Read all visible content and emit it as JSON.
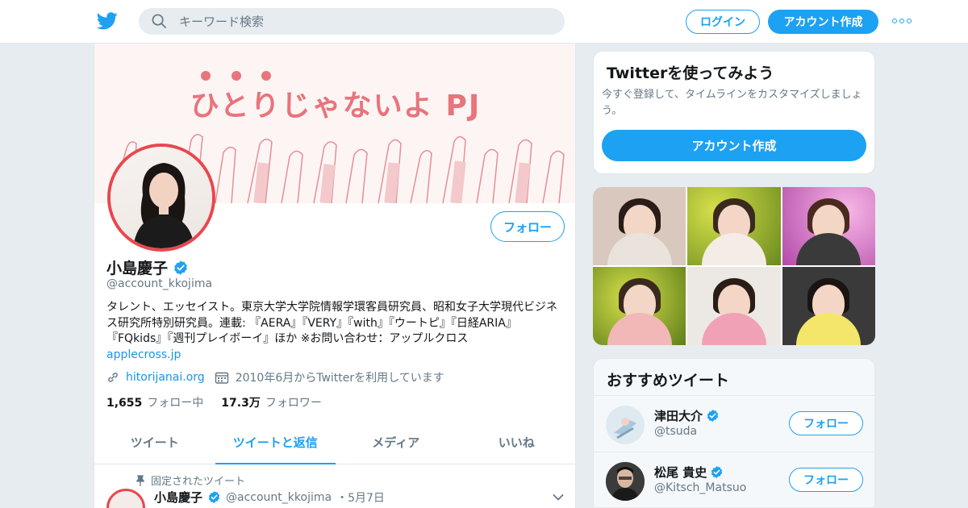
{
  "topbar": {
    "search_placeholder": "キーワード検索",
    "login_label": "ログイン",
    "signup_label": "アカウント作成"
  },
  "profile": {
    "banner_title": "ひとりじゃないよ PJ",
    "follow_label": "フォロー",
    "name": "小島慶子",
    "handle": "@account_kkojima",
    "bio": "タレント、エッセイスト。東京大学大学院情報学環客員研究員、昭和女子大学現代ビジネス研究所特別研究員。連載: 『AERA』『VERY』『with』『ウートピ』『日経ARIA』『FQkids』『週刊プレイボーイ』ほか ※お問い合わせ：アップルクロス",
    "bio_link": "applecross.jp",
    "website": "hitorijanai.org",
    "joined": "2010年6月からTwitterを利用しています",
    "following_count": "1,655",
    "following_label": "フォロー中",
    "followers_count": "17.3万",
    "followers_label": "フォロワー"
  },
  "tabs": [
    {
      "label": "ツイート",
      "active": false
    },
    {
      "label": "ツイートと返信",
      "active": true
    },
    {
      "label": "メディア",
      "active": false
    },
    {
      "label": "いいね",
      "active": false
    }
  ],
  "pinned_tweet": {
    "pinned_label": "固定されたツイート",
    "name": "小島慶子",
    "handle": "@account_kkojima",
    "date": "・5月7日"
  },
  "signup_card": {
    "title": "Twitterを使ってみよう",
    "text": "今すぐ登録して、タイムラインをカスタマイズしましょう。",
    "button_label": "アカウント作成"
  },
  "recommendations": {
    "title": "おすすめツイート",
    "items": [
      {
        "name": "津田大介",
        "handle": "@tsuda",
        "button_label": "フォロー"
      },
      {
        "name": "松尾 貴史",
        "handle": "@Kitsch_Matsuo",
        "button_label": "フォロー"
      }
    ]
  },
  "colors": {
    "accent": "#1da1f2",
    "banner_text": "#e8747c",
    "avatar_ring": "#e8474f"
  }
}
